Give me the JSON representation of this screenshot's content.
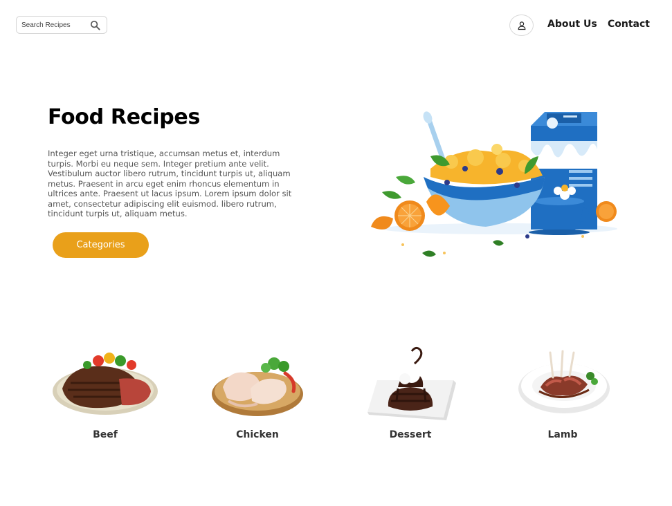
{
  "header": {
    "search": {
      "placeholder": "Search Recipes",
      "value": ""
    },
    "nav": {
      "about_label": "About Us",
      "contact_label": "Contact"
    }
  },
  "hero": {
    "title": "Food Recipes",
    "description": "Integer eget urna tristique, accumsan metus et, interdum turpis. Morbi eu neque sem. Integer pretium ante velit. Vestibulum auctor libero rutrum, tincidunt turpis ut, aliquam metus. Praesent in arcu eget enim rhoncus elementum in ultrices ante. Praesent ut lacus ipsum. Lorem ipsum dolor sit amet, consectetur adipiscing elit euismod. libero rutrum, tincidunt turpis ut, aliquam metus.",
    "button_label": "Categories"
  },
  "categories": [
    {
      "label": "Beef"
    },
    {
      "label": "Chicken"
    },
    {
      "label": "Dessert"
    },
    {
      "label": "Lamb"
    }
  ],
  "colors": {
    "accent": "#e9a01a",
    "illustration_blue": "#1f6fc2",
    "illustration_orange": "#f08a1c"
  }
}
